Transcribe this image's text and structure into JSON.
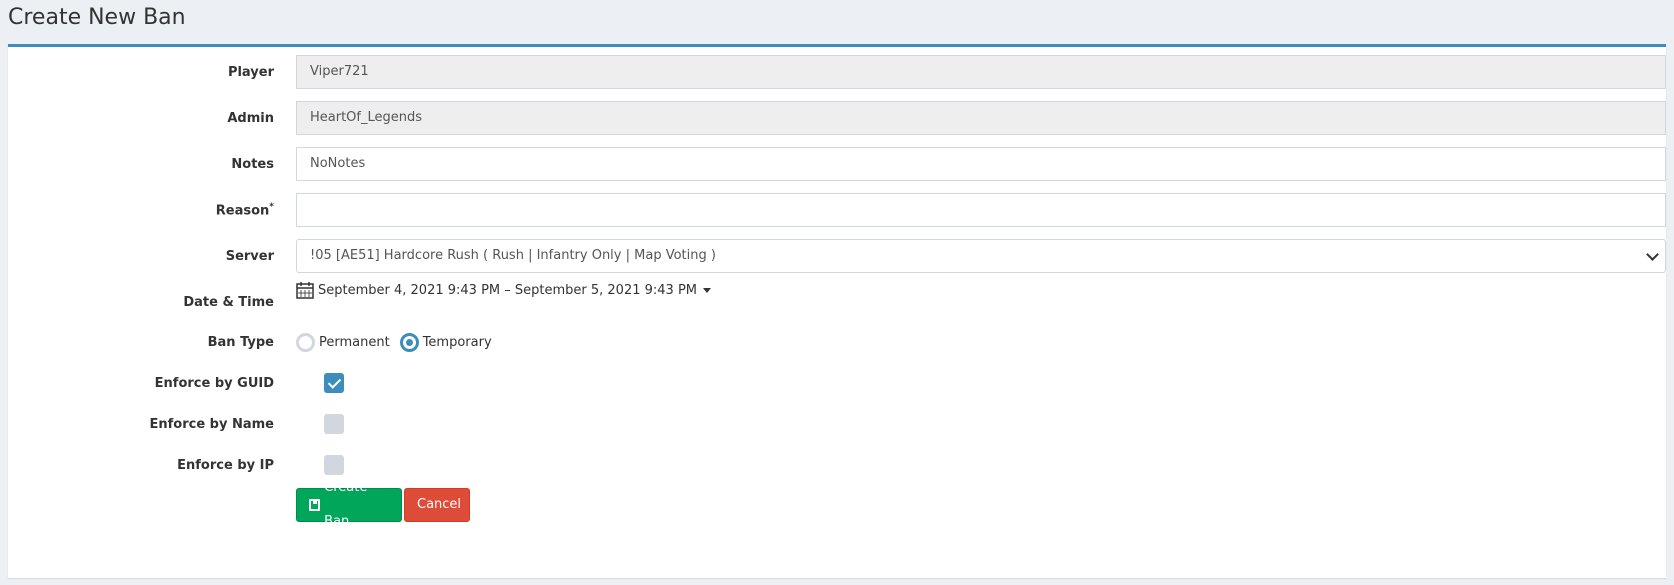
{
  "page": {
    "title": "Create New Ban"
  },
  "form": {
    "player": {
      "label": "Player",
      "value": "Viper721"
    },
    "admin": {
      "label": "Admin",
      "value": "HeartOf_Legends"
    },
    "notes": {
      "label": "Notes",
      "value": "NoNotes"
    },
    "reason": {
      "label": "Reason",
      "required_mark": "*",
      "value": ""
    },
    "server": {
      "label": "Server",
      "selected": "!05 [AE51] Hardcore Rush ( Rush | Infantry Only | Map Voting )"
    },
    "datetime": {
      "label": "Date & Time",
      "value": "September 4, 2021 9:43 PM – September 5, 2021 9:43 PM"
    },
    "ban_type": {
      "label": "Ban Type",
      "options": [
        "Permanent",
        "Temporary"
      ],
      "selected": "Temporary"
    },
    "enforce_guid": {
      "label": "Enforce by GUID",
      "checked": true
    },
    "enforce_name": {
      "label": "Enforce by Name",
      "checked": false
    },
    "enforce_ip": {
      "label": "Enforce by IP",
      "checked": false
    }
  },
  "actions": {
    "create_label": "Create Ban",
    "cancel_label": "Cancel"
  },
  "colors": {
    "primary": "#3c8dbc",
    "success": "#00a65a",
    "danger": "#dd4b39"
  }
}
